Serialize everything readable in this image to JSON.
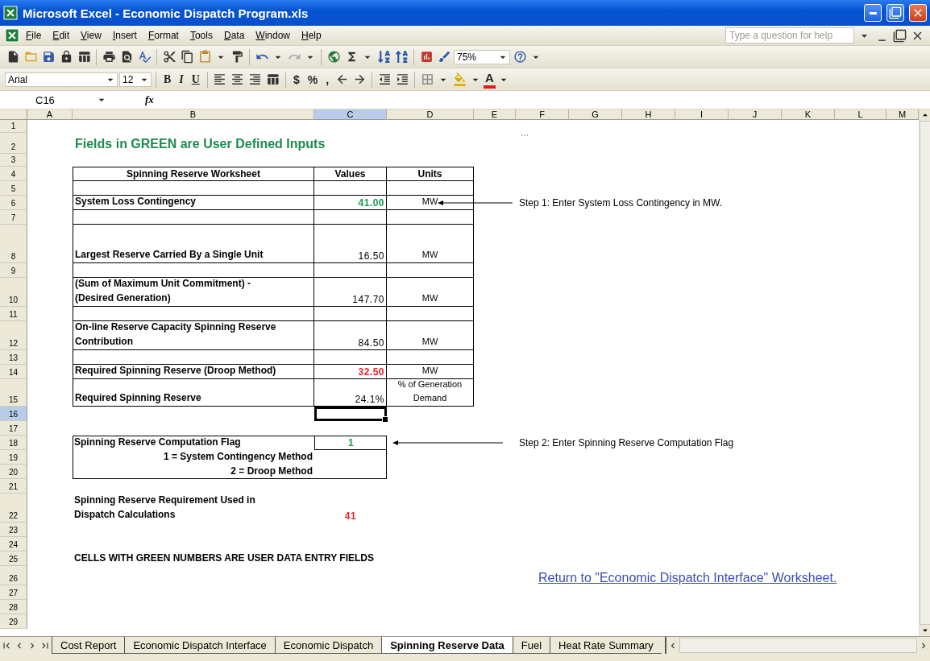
{
  "window": {
    "title": "Microsoft Excel - Economic Dispatch Program.xls"
  },
  "menu": {
    "items": [
      "File",
      "Edit",
      "View",
      "Insert",
      "Format",
      "Tools",
      "Data",
      "Window",
      "Help"
    ],
    "help_search": {
      "placeholder": "Type a question for help"
    }
  },
  "standard_toolbar": {
    "zoom": "75%"
  },
  "formatting_toolbar": {
    "font": "Arial",
    "size": "12",
    "bold": "B",
    "italic": "I",
    "underline": "U",
    "currency": "$",
    "percent": "%",
    "comma": ",",
    "font_color": "A"
  },
  "formula_bar": {
    "name_box": "C16",
    "function_label": "fx"
  },
  "columns": [
    {
      "label": "A",
      "selected": false
    },
    {
      "label": "B",
      "selected": false
    },
    {
      "label": "C",
      "selected": true
    },
    {
      "label": "D",
      "selected": false
    },
    {
      "label": "E",
      "selected": false
    },
    {
      "label": "F",
      "selected": false
    },
    {
      "label": "G",
      "selected": false
    },
    {
      "label": "H",
      "selected": false
    },
    {
      "label": "I",
      "selected": false
    },
    {
      "label": "J",
      "selected": false
    },
    {
      "label": "K",
      "selected": false
    },
    {
      "label": "L",
      "selected": false
    },
    {
      "label": "M",
      "selected": false
    }
  ],
  "rows": [
    {
      "label": "1",
      "selected": false
    },
    {
      "label": "2",
      "selected": false
    },
    {
      "label": "3",
      "selected": false
    },
    {
      "label": "4",
      "selected": false
    },
    {
      "label": "5",
      "selected": false
    },
    {
      "label": "6",
      "selected": false
    },
    {
      "label": "7",
      "selected": false
    },
    {
      "label": "8",
      "selected": false
    },
    {
      "label": "9",
      "selected": false
    },
    {
      "label": "10",
      "selected": false
    },
    {
      "label": "11",
      "selected": false
    },
    {
      "label": "12",
      "selected": false
    },
    {
      "label": "13",
      "selected": false
    },
    {
      "label": "14",
      "selected": false
    },
    {
      "label": "15",
      "selected": false
    },
    {
      "label": "16",
      "selected": true
    },
    {
      "label": "17",
      "selected": false
    },
    {
      "label": "18",
      "selected": false
    },
    {
      "label": "19",
      "selected": false
    },
    {
      "label": "20",
      "selected": false
    },
    {
      "label": "21",
      "selected": false
    },
    {
      "label": "22",
      "selected": false
    },
    {
      "label": "23",
      "selected": false
    },
    {
      "label": "24",
      "selected": false
    },
    {
      "label": "25",
      "selected": false
    },
    {
      "label": "26",
      "selected": false
    },
    {
      "label": "27",
      "selected": false
    },
    {
      "label": "28",
      "selected": false
    },
    {
      "label": "29",
      "selected": false
    }
  ],
  "sheet": {
    "title": "Fields in GREEN are User Defined Inputs",
    "stray_mark": "```",
    "worksheet_table": {
      "headers": [
        "Spinning Reserve Worksheet",
        "Values",
        "Units"
      ],
      "rows": [
        {
          "kind": "blank"
        },
        {
          "kind": "data",
          "label": "System Loss Contingency",
          "value": "41.00",
          "color": "#1b9a4e",
          "unit": "MW"
        },
        {
          "kind": "blank"
        },
        {
          "kind": "data",
          "label": "Largest Reserve Carried By a Single Unit",
          "value": "16.50",
          "color": "#000000",
          "unit": "MW"
        },
        {
          "kind": "blank"
        },
        {
          "kind": "data",
          "label": "(Sum of Maximum Unit Commitment) - (Desired Generation)",
          "value": "147.70",
          "color": "#000000",
          "unit": "MW"
        },
        {
          "kind": "blank"
        },
        {
          "kind": "data",
          "label": "On-line Reserve Capacity Spinning Reserve Contribution",
          "value": "84.50",
          "color": "#000000",
          "unit": "MW"
        },
        {
          "kind": "blank"
        },
        {
          "kind": "data",
          "label": "Required Spinning Reserve (Droop Method)",
          "value": "32.50",
          "color": "#ee1f24",
          "unit": "MW"
        },
        {
          "kind": "data",
          "label": "Required Spinning Reserve",
          "value": "24.1%",
          "color": "#000000",
          "unit": "% of Generation Demand"
        }
      ]
    },
    "step_notes": [
      {
        "text": "Step 1: Enter System Loss Contingency in MW."
      },
      {
        "text": "Step 2: Enter Spinning Reserve Computation Flag"
      }
    ],
    "flag_box": {
      "label": "Spinning Reserve Computation Flag",
      "value": "1",
      "color": "#1b9a4e",
      "options": [
        "1 = System Contingency Method",
        "2 = Droop Method"
      ]
    },
    "requirement": {
      "label": "Spinning Reserve Requirement Used in Dispatch Calculations",
      "value": "41",
      "color": "#ee1f24"
    },
    "notice": "CELLS WITH GREEN NUMBERS ARE USER DATA ENTRY FIELDS",
    "link": "Return to \"Economic Dispatch Interface\" Worksheet."
  },
  "sheet_tabs": [
    {
      "label": "Cost Report",
      "selected": false
    },
    {
      "label": "Economic Dispatch Interface",
      "selected": false
    },
    {
      "label": "Economic Dispatch",
      "selected": false
    },
    {
      "label": "Spinning Reserve Data",
      "selected": true
    },
    {
      "label": "Fuel",
      "selected": false
    },
    {
      "label": "Heat Rate Summary",
      "selected": false
    }
  ]
}
